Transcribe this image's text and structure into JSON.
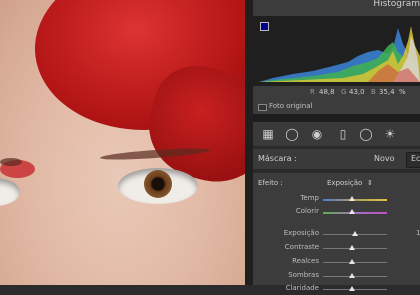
{
  "histogram": {
    "title": "Histogram",
    "r_label": "R",
    "r_value": "48,8",
    "g_label": "G",
    "g_value": "43,0",
    "b_label": "B",
    "b_value": "35,4",
    "unit": "%",
    "foto_original": "Foto original"
  },
  "toolbar": {
    "tools": [
      "crop-grid-icon",
      "spot-removal-icon",
      "red-eye-icon",
      "graduated-filter-icon",
      "radial-filter-icon",
      "adjustment-brush-icon"
    ]
  },
  "mask": {
    "label": "Máscara :",
    "new_label": "Novo",
    "edit_label": "Ec"
  },
  "effect": {
    "label": "Efeito :",
    "value": "Exposição",
    "arrows": "⇕"
  },
  "sliders": [
    {
      "label": "Temp",
      "pos": 0.45,
      "kind": "temp"
    },
    {
      "label": "Colorir",
      "pos": 0.45,
      "kind": "tint"
    },
    {
      "label": "Exposição",
      "pos": 0.5,
      "kind": "plain",
      "value": "1"
    },
    {
      "label": "Contraste",
      "pos": 0.45,
      "kind": "plain"
    },
    {
      "label": "Realces",
      "pos": 0.45,
      "kind": "plain"
    },
    {
      "label": "Sombras",
      "pos": 0.45,
      "kind": "plain"
    },
    {
      "label": "Claridade",
      "pos": 0.45,
      "kind": "plain"
    }
  ],
  "colors": {
    "panel_bg": "#3c3c3c",
    "hist_bg": "#1f1f1f",
    "hair_red": "#b31515",
    "clip_swatch": "#00008b"
  }
}
